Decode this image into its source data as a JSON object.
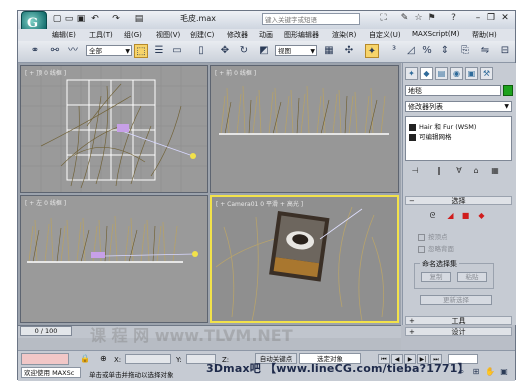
{
  "title": {
    "app_logo": "G",
    "document_name": "毛皮.max",
    "search_placeholder": "键入关键字或短语",
    "quick_access": [
      "新建",
      "打开",
      "保存",
      "撤销",
      "重做"
    ]
  },
  "menu": [
    "编辑(E)",
    "工具(T)",
    "组(G)",
    "视图(V)",
    "创建(C)",
    "修改器",
    "动画",
    "图形编辑器",
    "渲染(R)",
    "自定义(U)",
    "MAXScript(M)",
    "帮助(H)"
  ],
  "toolbar": {
    "selection_filter": "全部",
    "reference_coord": "视图"
  },
  "viewports": [
    {
      "id": "top",
      "label": "[ + 顶 0 线框 ]"
    },
    {
      "id": "front",
      "label": "[ + 前 0 线框 ]"
    },
    {
      "id": "left",
      "label": "[ + 左 0 线框 ]"
    },
    {
      "id": "camera",
      "label": "[ + Camera01 0 平滑 + 高光 ]"
    }
  ],
  "command_panel": {
    "object_name": "地毯",
    "object_color": "#1da21d",
    "modifier_list_label": "修改器列表",
    "stack": [
      "Hair 和 Fur (WSM)",
      "可编辑网格"
    ],
    "selection_rollout": "选择",
    "checkboxes": [
      "按顶点",
      "忽略背面"
    ],
    "named_sel_title": "命名选择集",
    "named_sel_buttons": [
      "复制",
      "粘贴"
    ],
    "update_selection": "更新选择",
    "tools_rollout": "工具",
    "design_rollout": "设计"
  },
  "timeline": {
    "frame": "0 / 100"
  },
  "status": {
    "script_box": "欢迎使用 MAXSc",
    "prompt": "单击或单击并拖动以选择对象",
    "x_label": "X:",
    "y_label": "Y:",
    "z_label": "Z:",
    "autokey": "自动关键点",
    "setkey": "设置关键点",
    "selected_object": "选定对象"
  },
  "watermark": "3Dmax吧  【www.lineCG.com/tieba?1771】",
  "faint_watermark": "课 程 网 www.TLVM.NET"
}
